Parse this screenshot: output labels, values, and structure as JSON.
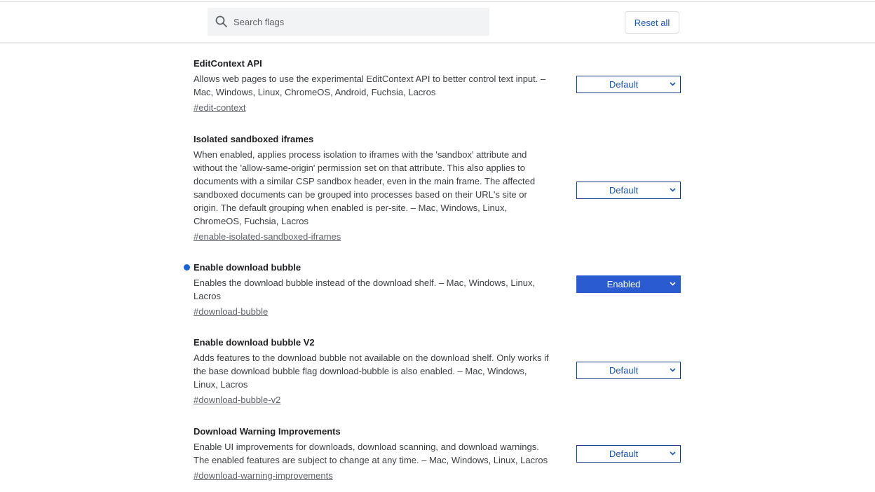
{
  "header": {
    "search_placeholder": "Search flags",
    "reset_label": "Reset all"
  },
  "flags": [
    {
      "title": "EditContext API",
      "lines": [
        "Allows web pages to use the experimental EditContext API to better control text input. –",
        "Mac, Windows, Linux, ChromeOS, Android, Fuchsia, Lacros"
      ],
      "link": "#edit-context",
      "value": "Default",
      "modified": false
    },
    {
      "title": "Isolated sandboxed iframes",
      "lines": [
        "When enabled, applies process isolation to iframes with the 'sandbox' attribute and",
        "without the 'allow-same-origin' permission set on that attribute. This also applies to",
        "documents with a similar CSP sandbox header, even in the main frame. The affected",
        "sandboxed documents can be grouped into processes based on their URL's site or",
        "origin. The default grouping when enabled is per-site. – Mac, Windows, Linux,",
        "ChromeOS, Fuchsia, Lacros"
      ],
      "link": "#enable-isolated-sandboxed-iframes",
      "value": "Default",
      "modified": false
    },
    {
      "title": "Enable download bubble",
      "lines": [
        "Enables the download bubble instead of the download shelf. – Mac, Windows, Linux,",
        "Lacros"
      ],
      "link": "#download-bubble",
      "value": "Enabled",
      "modified": true
    },
    {
      "title": "Enable download bubble V2",
      "lines": [
        "Adds features to the download bubble not available on the download shelf. Only works if",
        "the base download bubble flag download-bubble is also enabled. – Mac, Windows,",
        "Linux, Lacros"
      ],
      "link": "#download-bubble-v2",
      "value": "Default",
      "modified": false
    },
    {
      "title": "Download Warning Improvements",
      "lines": [
        "Enable UI improvements for downloads, download scanning, and download warnings.",
        "The enabled features are subject to change at any time. – Mac, Windows, Linux, Lacros"
      ],
      "link": "#download-warning-improvements",
      "value": "Default",
      "modified": false
    }
  ],
  "colors": {
    "accent": "#2a5bd0",
    "link": "#1a57b8",
    "modified_dot": "#1a62d8"
  }
}
